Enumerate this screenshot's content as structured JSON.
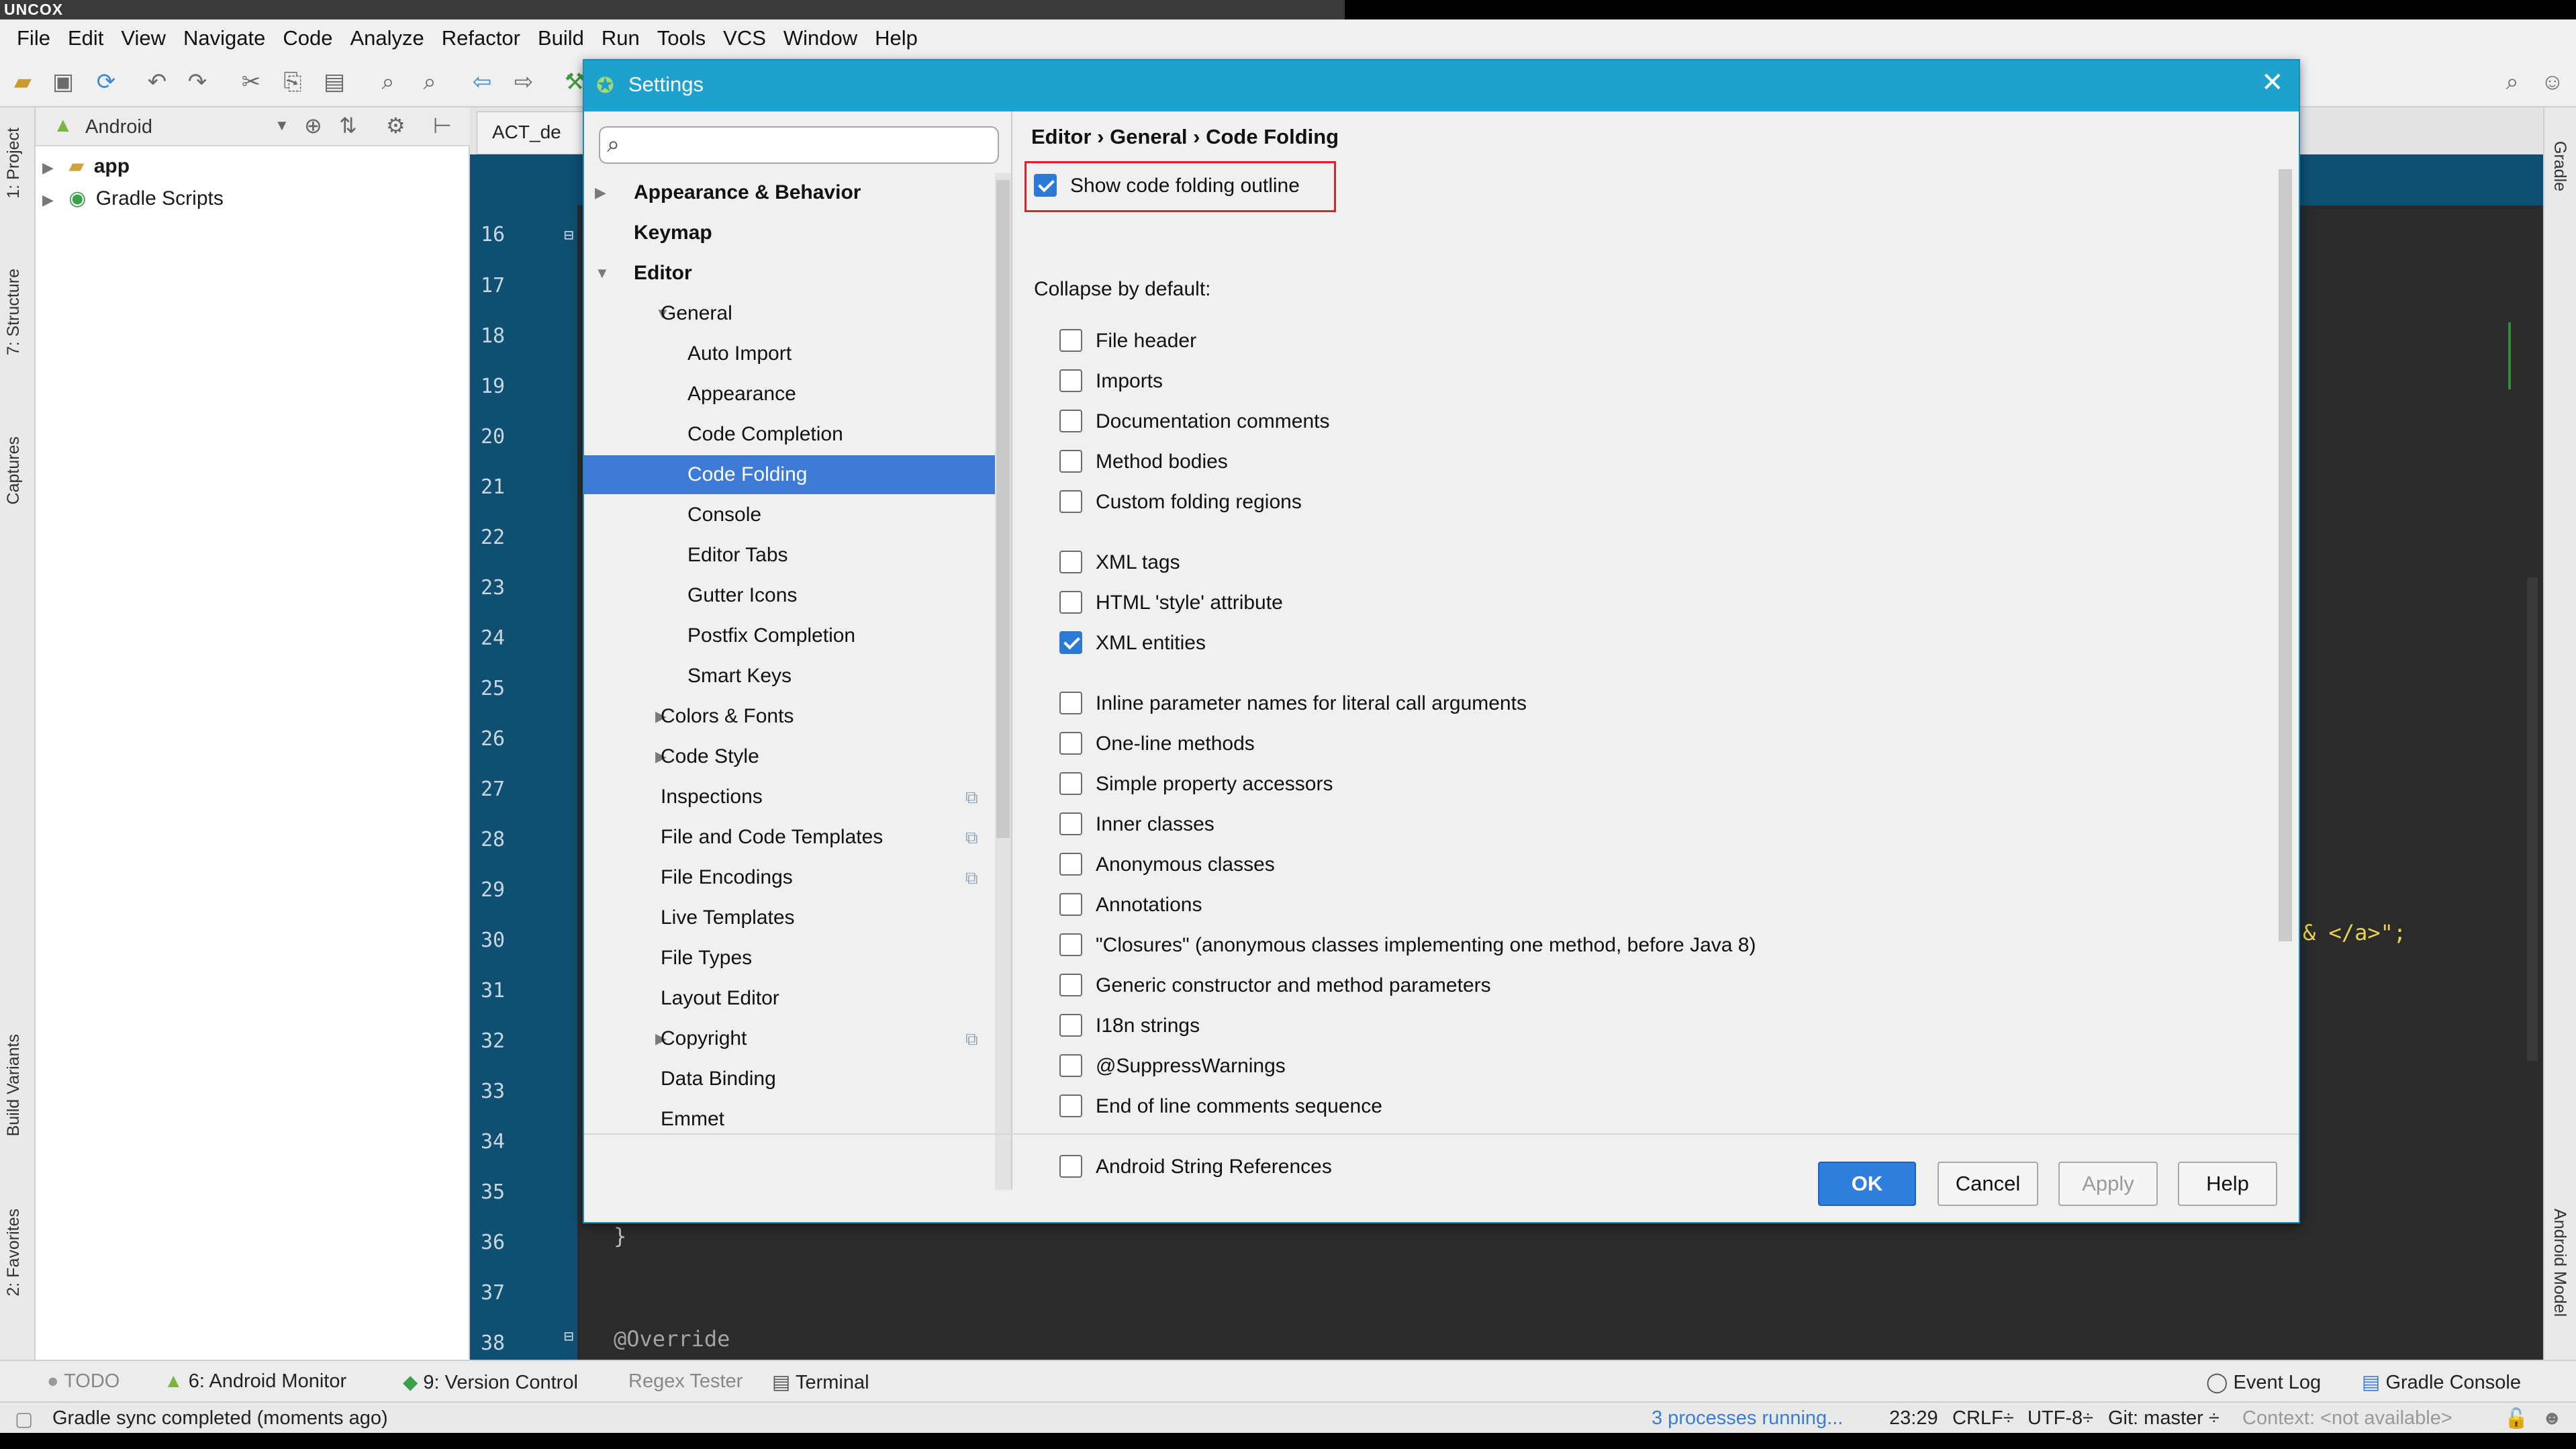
{
  "top_strip": {
    "logo": "UNCOX"
  },
  "menu": [
    "File",
    "Edit",
    "View",
    "Navigate",
    "Code",
    "Analyze",
    "Refactor",
    "Build",
    "Run",
    "Tools",
    "VCS",
    "Window",
    "Help"
  ],
  "left_tool_tabs": [
    "1: Project",
    "7: Structure",
    "Captures",
    "Build Variants",
    "2: Favorites"
  ],
  "right_tool_tabs": [
    "Gradle",
    "Android Model"
  ],
  "project": {
    "view_selector": "Android",
    "tree": [
      {
        "label": "app",
        "bold": true
      },
      {
        "label": "Gradle Scripts",
        "bold": false
      }
    ]
  },
  "editor": {
    "tab_label": "ACT_de",
    "line_numbers": [
      "16",
      "17",
      "18",
      "19",
      "20",
      "21",
      "22",
      "23",
      "24",
      "25",
      "26",
      "27",
      "28",
      "29",
      "30",
      "31",
      "32",
      "33",
      "34",
      "35",
      "36",
      "37",
      "38"
    ],
    "visible_code": {
      "string_fragment": "& </a>\";",
      "brace": "}",
      "annotation": "@Override"
    }
  },
  "dialog": {
    "title": "Settings",
    "search_placeholder": "",
    "tree": [
      {
        "label": "Appearance & Behavior",
        "level": 0,
        "arrow": "right",
        "bold": true
      },
      {
        "label": "Keymap",
        "level": 0,
        "arrow": "",
        "bold": true
      },
      {
        "label": "Editor",
        "level": 0,
        "arrow": "down",
        "bold": true
      },
      {
        "label": "General",
        "level": 1,
        "arrow": "down"
      },
      {
        "label": "Auto Import",
        "level": 2
      },
      {
        "label": "Appearance",
        "level": 2
      },
      {
        "label": "Code Completion",
        "level": 2
      },
      {
        "label": "Code Folding",
        "level": 2,
        "selected": true
      },
      {
        "label": "Console",
        "level": 2
      },
      {
        "label": "Editor Tabs",
        "level": 2
      },
      {
        "label": "Gutter Icons",
        "level": 2
      },
      {
        "label": "Postfix Completion",
        "level": 2
      },
      {
        "label": "Smart Keys",
        "level": 2
      },
      {
        "label": "Colors & Fonts",
        "level": 1,
        "arrow": "right"
      },
      {
        "label": "Code Style",
        "level": 1,
        "arrow": "right"
      },
      {
        "label": "Inspections",
        "level": 1,
        "copy": true
      },
      {
        "label": "File and Code Templates",
        "level": 1,
        "copy": true
      },
      {
        "label": "File Encodings",
        "level": 1,
        "copy": true
      },
      {
        "label": "Live Templates",
        "level": 1
      },
      {
        "label": "File Types",
        "level": 1
      },
      {
        "label": "Layout Editor",
        "level": 1
      },
      {
        "label": "Copyright",
        "level": 1,
        "arrow": "right",
        "copy": true
      },
      {
        "label": "Data Binding",
        "level": 1
      },
      {
        "label": "Emmet",
        "level": 1
      }
    ],
    "breadcrumb": "Editor › General › Code Folding",
    "show_outline": {
      "label": "Show code folding outline",
      "checked": true
    },
    "collapse_label": "Collapse by default:",
    "groups": [
      [
        {
          "label": "File header",
          "checked": false
        },
        {
          "label": "Imports",
          "checked": false
        },
        {
          "label": "Documentation comments",
          "checked": false
        },
        {
          "label": "Method bodies",
          "checked": false
        },
        {
          "label": "Custom folding regions",
          "checked": false
        }
      ],
      [
        {
          "label": "XML tags",
          "checked": false
        },
        {
          "label": "HTML 'style' attribute",
          "checked": false
        },
        {
          "label": "XML entities",
          "checked": true
        }
      ],
      [
        {
          "label": "Inline parameter names for literal call arguments",
          "checked": false
        },
        {
          "label": "One-line methods",
          "checked": false
        },
        {
          "label": "Simple property accessors",
          "checked": false
        },
        {
          "label": "Inner classes",
          "checked": false
        },
        {
          "label": "Anonymous classes",
          "checked": false
        },
        {
          "label": "Annotations",
          "checked": false
        },
        {
          "label": "\"Closures\" (anonymous classes implementing one method, before Java 8)",
          "checked": false
        },
        {
          "label": "Generic constructor and method parameters",
          "checked": false
        },
        {
          "label": "I18n strings",
          "checked": false
        },
        {
          "label": "@SuppressWarnings",
          "checked": false
        },
        {
          "label": "End of line comments sequence",
          "checked": false
        }
      ],
      [
        {
          "label": "Android String References",
          "checked": false
        }
      ]
    ],
    "buttons": {
      "ok": "OK",
      "cancel": "Cancel",
      "apply": "Apply",
      "help": "Help"
    }
  },
  "bottom_tabs": {
    "todo": "TODO",
    "android_monitor": "6: Android Monitor",
    "version_control": "9: Version Control",
    "regex_tester": "Regex Tester",
    "terminal": "Terminal",
    "event_log": "Event Log",
    "gradle_console": "Gradle Console"
  },
  "status": {
    "message": "Gradle sync completed (moments ago)",
    "processes": "3 processes running...",
    "position": "23:29",
    "line_sep": "CRLF÷",
    "encoding": "UTF-8÷",
    "git": "Git: master ÷",
    "context": "Context: <not available>"
  },
  "colors": {
    "dialog_title": "#1ea1cc",
    "selection": "#3d7bd6",
    "ok_button": "#2e7fdc",
    "highlight_box": "#e0202a",
    "gutter": "#0f4f72",
    "editor_bg": "#2b2b2b"
  }
}
